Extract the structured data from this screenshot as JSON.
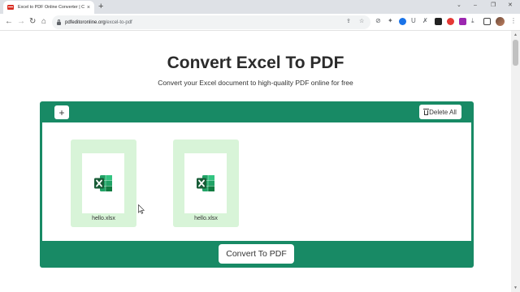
{
  "browser": {
    "tab_title": "Excel to PDF Online Converter | C",
    "tab_close": "×",
    "new_tab": "+",
    "url_host": "pdfeditoronline.org",
    "url_path": "/excel-to-pdf",
    "window_controls": {
      "collapse": "⌄",
      "minimize": "–",
      "restore": "❐",
      "close": "✕"
    },
    "nav": {
      "back": "←",
      "forward": "→",
      "reload": "↻",
      "home": "⌂"
    }
  },
  "page": {
    "title": "Convert Excel To PDF",
    "subtitle": "Convert your Excel document to high-quality PDF online for free",
    "add_label": "+",
    "delete_all_label": "Delete All",
    "convert_label": "Convert To PDF",
    "files": [
      {
        "name": "hello.xlsx",
        "icon": "excel-file-icon"
      },
      {
        "name": "hello.xlsx",
        "icon": "excel-file-icon"
      }
    ]
  },
  "colors": {
    "panel_green": "#188a65",
    "card_bg": "#d8f4d8",
    "excel_green": "#1d6f42",
    "excel_light": "#21a366"
  }
}
